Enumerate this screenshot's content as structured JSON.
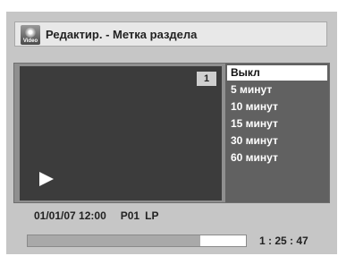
{
  "header": {
    "icon": "video-disc-icon",
    "icon_label": "Video",
    "title": "Редактир. - Метка раздела"
  },
  "player": {
    "chapter_number": "1",
    "play_icon": "play-icon"
  },
  "menu": {
    "items": [
      {
        "label": "Выкл",
        "selected": true
      },
      {
        "label": "5 минут",
        "selected": false
      },
      {
        "label": "10 минут",
        "selected": false
      },
      {
        "label": "15 минут",
        "selected": false
      },
      {
        "label": "30 минут",
        "selected": false
      },
      {
        "label": "60 минут",
        "selected": false
      }
    ]
  },
  "status": {
    "datetime": "01/01/07 12:00",
    "program": "P01",
    "mode": "LP",
    "elapsed": "1 : 25 : 47",
    "progress_fraction": 0.79
  }
}
